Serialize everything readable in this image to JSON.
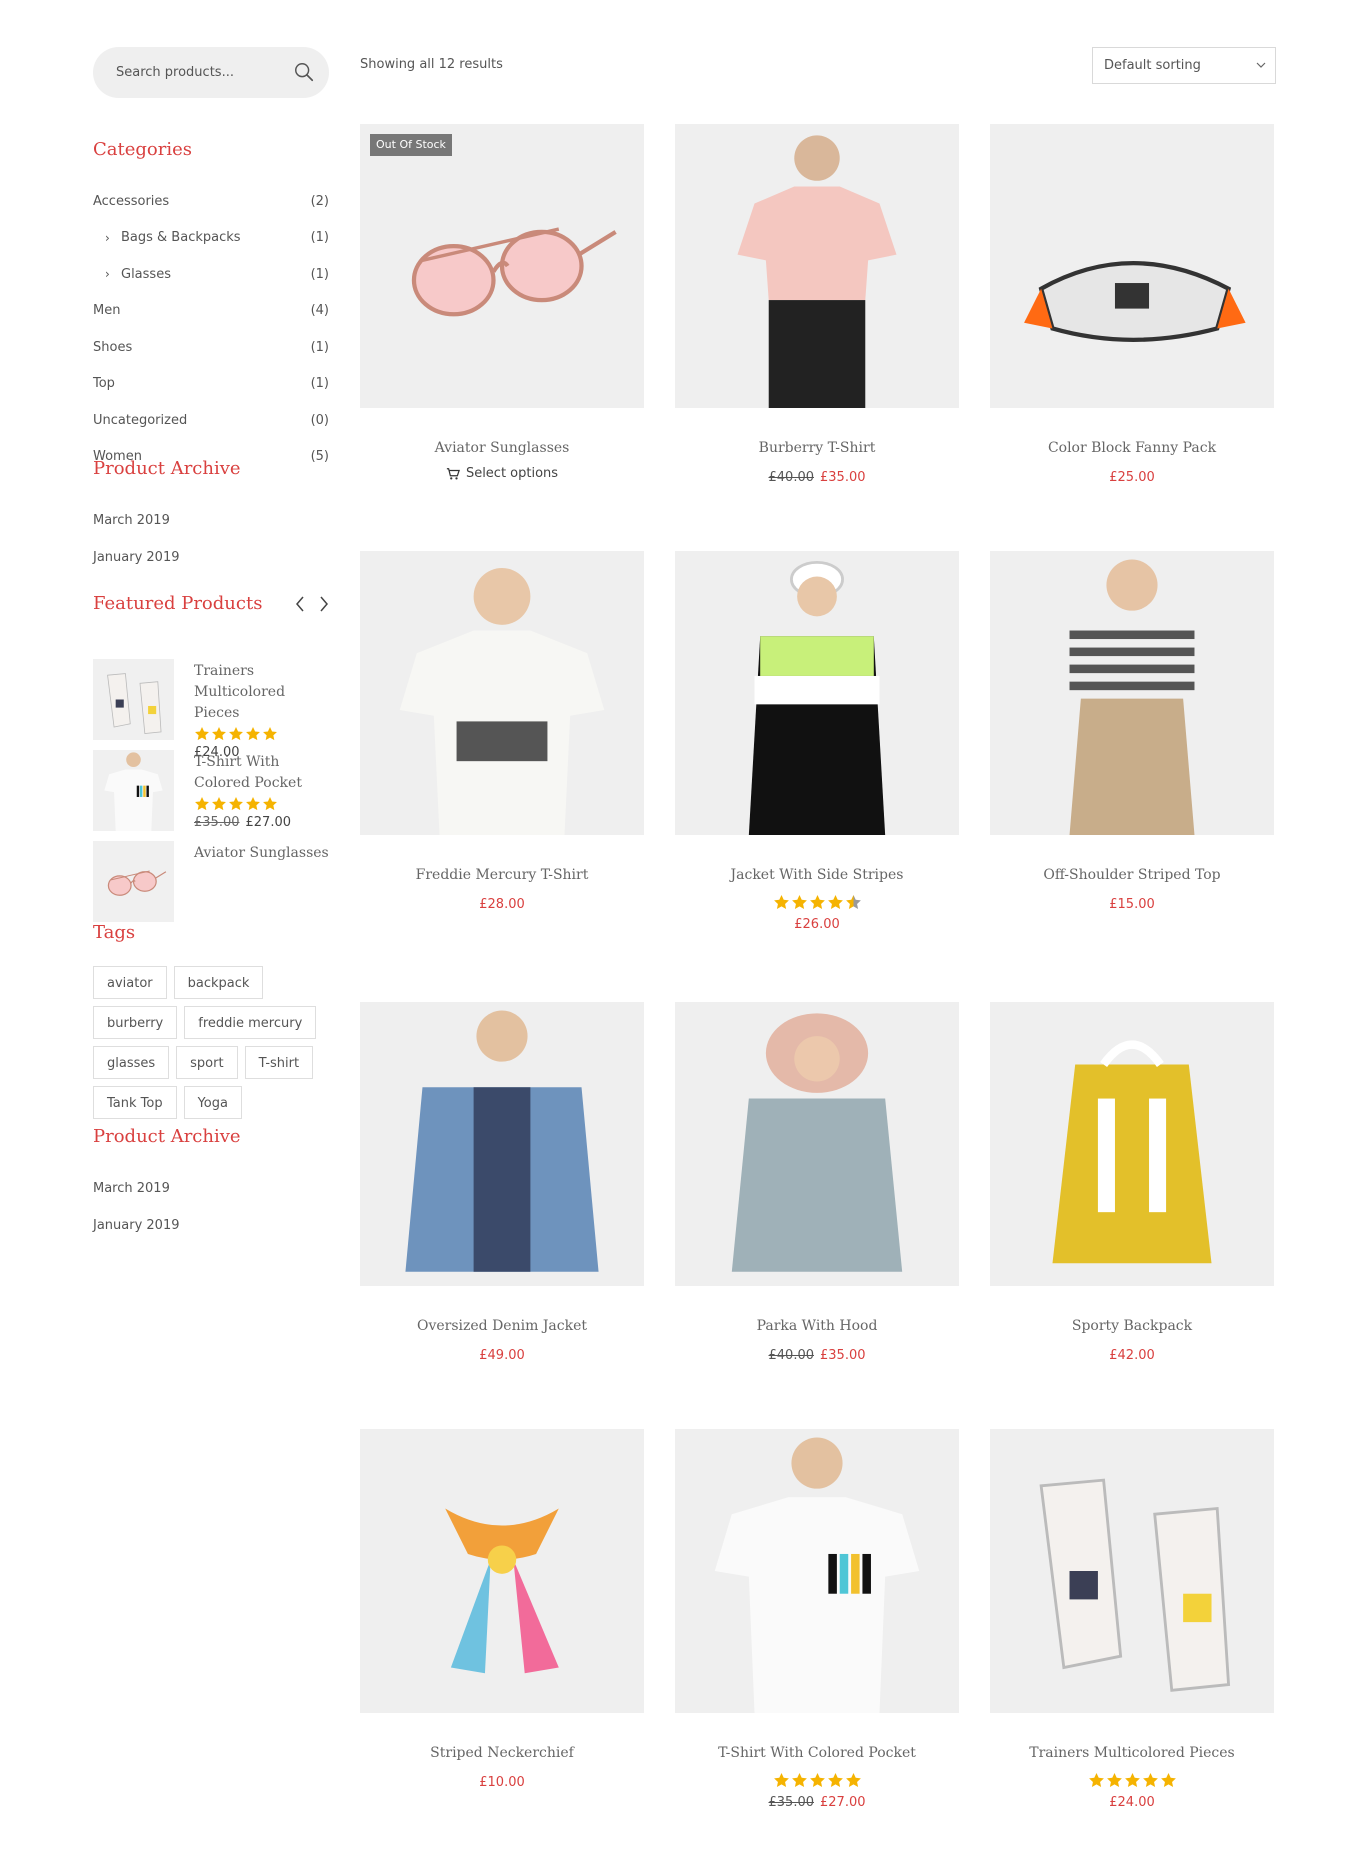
{
  "search": {
    "placeholder": "Search products..."
  },
  "sidebar": {
    "categories_title": "Categories",
    "categories": [
      {
        "label": "Accessories",
        "count": "(2)",
        "sub": false
      },
      {
        "label": "Bags & Backpacks",
        "count": "(1)",
        "sub": true
      },
      {
        "label": "Glasses",
        "count": "(1)",
        "sub": true
      },
      {
        "label": "Men",
        "count": "(4)",
        "sub": false
      },
      {
        "label": "Shoes",
        "count": "(1)",
        "sub": false
      },
      {
        "label": "Top",
        "count": "(1)",
        "sub": false
      },
      {
        "label": "Uncategorized",
        "count": "(0)",
        "sub": false
      },
      {
        "label": "Women",
        "count": "(5)",
        "sub": false
      }
    ],
    "archive_title": "Product Archive",
    "archive": [
      "March 2019",
      "January 2019"
    ],
    "featured_title": "Featured Products",
    "featured": [
      {
        "name": "Trainers Multicolored Pieces",
        "rating": 5,
        "old_price": "",
        "price": "£24.00"
      },
      {
        "name": "T-Shirt With Colored Pocket",
        "rating": 5,
        "old_price": "£35.00",
        "price": "£27.00"
      },
      {
        "name": "Aviator Sunglasses",
        "rating": 0,
        "old_price": "",
        "price": ""
      }
    ],
    "tags_title": "Tags",
    "tags": [
      "aviator",
      "backpack",
      "burberry",
      "freddie mercury",
      "glasses",
      "sport",
      "T-shirt",
      "Tank Top",
      "Yoga"
    ],
    "archive2_title": "Product Archive",
    "archive2": [
      "March 2019",
      "January 2019"
    ]
  },
  "main": {
    "result_count": "Showing all 12 results",
    "sorting": "Default sorting",
    "products": [
      {
        "title": "Aviator Sunglasses",
        "badge": "Out Of Stock",
        "action": "Select options",
        "old_price": "",
        "price": "",
        "rating": 0,
        "image": "sunglasses"
      },
      {
        "title": "Burberry T-Shirt",
        "badge": "",
        "action": "",
        "old_price": "£40.00",
        "price": "£35.00",
        "rating": 0,
        "image": "pink-tshirt"
      },
      {
        "title": "Color Block Fanny Pack",
        "badge": "",
        "action": "",
        "old_price": "",
        "price": "£25.00",
        "rating": 0,
        "image": "fanny-pack"
      },
      {
        "title": "Freddie Mercury T-Shirt",
        "badge": "",
        "action": "",
        "old_price": "",
        "price": "£28.00",
        "rating": 0,
        "image": "white-tshirt"
      },
      {
        "title": "Jacket With Side Stripes",
        "badge": "",
        "action": "",
        "old_price": "",
        "price": "£26.00",
        "rating": 4.5,
        "image": "track-jacket"
      },
      {
        "title": "Off-Shoulder Striped Top",
        "badge": "",
        "action": "",
        "old_price": "",
        "price": "£15.00",
        "rating": 0,
        "image": "striped-top"
      },
      {
        "title": "Oversized Denim Jacket",
        "badge": "",
        "action": "",
        "old_price": "",
        "price": "£49.00",
        "rating": 0,
        "image": "denim-jacket"
      },
      {
        "title": "Parka With Hood",
        "badge": "",
        "action": "",
        "old_price": "£40.00",
        "price": "£35.00",
        "rating": 0,
        "image": "parka"
      },
      {
        "title": "Sporty Backpack",
        "badge": "",
        "action": "",
        "old_price": "",
        "price": "£42.00",
        "rating": 0,
        "image": "backpack"
      },
      {
        "title": "Striped Neckerchief",
        "badge": "",
        "action": "",
        "old_price": "",
        "price": "£10.00",
        "rating": 0,
        "image": "neckerchief"
      },
      {
        "title": "T-Shirt With Colored Pocket",
        "badge": "",
        "action": "",
        "old_price": "£35.00",
        "price": "£27.00",
        "rating": 5,
        "image": "pocket-tshirt"
      },
      {
        "title": "Trainers Multicolored Pieces",
        "badge": "",
        "action": "",
        "old_price": "",
        "price": "£24.00",
        "rating": 5,
        "image": "trainers"
      }
    ]
  },
  "colors": {
    "accent": "#d9403f",
    "star": "#f5b301",
    "image_bg": "#efefef"
  }
}
